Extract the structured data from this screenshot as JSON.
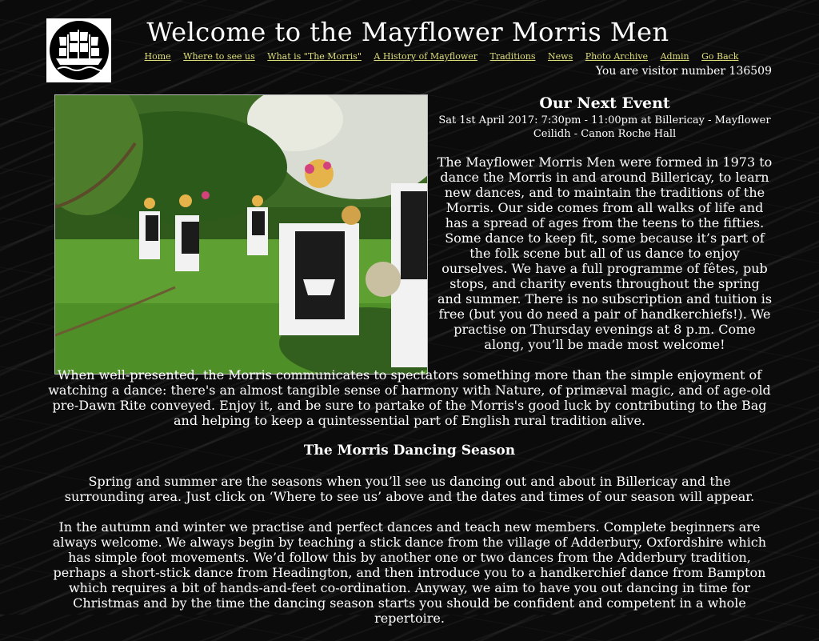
{
  "header": {
    "title": "Welcome to the Mayflower Morris Men",
    "logo_icon": "ship-icon",
    "visitor_text": "You are visitor number 136509"
  },
  "nav": {
    "items": [
      {
        "label": "Home"
      },
      {
        "label": "Where to see us"
      },
      {
        "label": "What is \"The Morris\""
      },
      {
        "label": "A History of Mayflower"
      },
      {
        "label": "Traditions"
      },
      {
        "label": "News"
      },
      {
        "label": "Photo Archive"
      },
      {
        "label": "Admin"
      },
      {
        "label": "Go Back"
      }
    ],
    "link_color": "#dede7a"
  },
  "event": {
    "heading": "Our Next Event",
    "detail": "Sat 1st April 2017: 7:30pm - 11:00pm at Billericay - Mayflower Ceilidh - Canon Roche Hall"
  },
  "content": {
    "intro": "The Mayflower Morris Men were formed in 1973 to dance the Morris in and around Billericay, to learn new dances, and to maintain the traditions of the Morris. Our side comes from all walks of life and has a spread of ages from the teens to the fifties. Some dance to keep fit, some because it’s part of the folk scene but all of us dance to enjoy ourselves. We have a full programme of fêtes, pub stops, and charity events throughout the spring and summer. There is no subscription and tuition is free (but you do need a pair of handkerchiefs!). We practise on Thursday evenings at 8 p.m. Come along, you’ll be made most welcome!",
    "paragraph_presented": "When well-presented, the Morris communicates to spectators something more than the simple enjoyment of watching a dance: there's an almost tangible sense of harmony with Nature, of primæval magic, and of age-old pre-Dawn Rite conveyed. Enjoy it, and be sure to partake of the Morris's good luck by contributing to the Bag and helping to keep a quintessential part of English rural tradition alive.",
    "season_heading": "The Morris Dancing Season",
    "paragraph_spring": "Spring and summer are the seasons when you’ll see us dancing out and about in Billericay and the surrounding area. Just click on ‘Where to see us’ above and the dates and times of our season will appear.",
    "paragraph_autumn": "In the autumn and winter we practise and perfect dances and teach new members. Complete beginners are always welcome. We always begin by teaching a stick dance from the village of Adderbury, Oxfordshire which has simple foot movements. We’d follow this by another one or two dances from the Adderbury tradition, perhaps a short-stick dance from Headington, and then introduce you to a handkerchief dance from Bampton which requires a bit of hands-and-feet co-ordination. Anyway, we aim to have you out dancing in time for Christmas and by the time the dancing season starts you should be confident and competent in a whole repertoire."
  }
}
